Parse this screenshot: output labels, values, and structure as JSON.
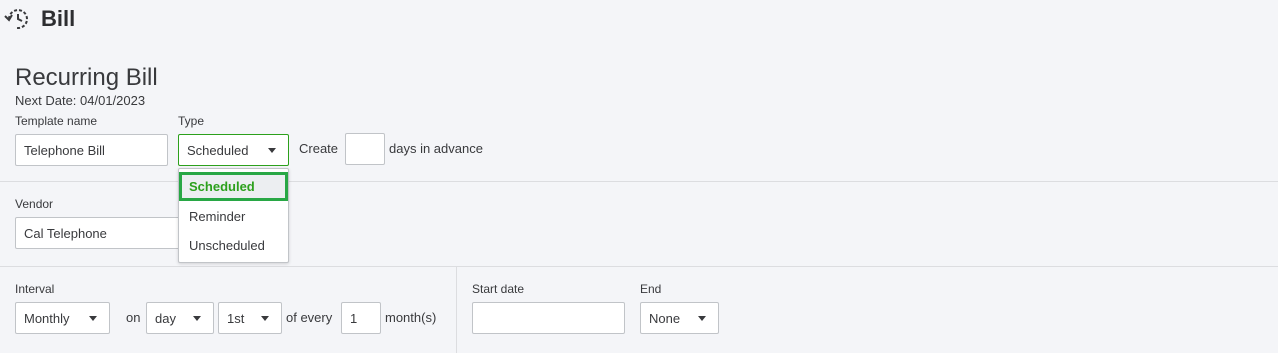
{
  "header": {
    "title": "Bill",
    "icon": "recurring-clock-icon"
  },
  "recurring": {
    "title": "Recurring Bill",
    "next_date": "Next Date: 04/01/2023"
  },
  "template_name": {
    "label": "Template name",
    "value": "Telephone Bill"
  },
  "type": {
    "label": "Type",
    "value": "Scheduled",
    "options": [
      "Scheduled",
      "Reminder",
      "Unscheduled"
    ],
    "selected_index": 0
  },
  "create": {
    "prefix": "Create",
    "value": "",
    "suffix": "days in advance"
  },
  "vendor": {
    "label": "Vendor",
    "value": "Cal Telephone"
  },
  "interval": {
    "label": "Interval",
    "value": "Monthly",
    "on_label": "on",
    "day_value": "day",
    "nth_value": "1st",
    "every_label": "of every",
    "every_value": "1",
    "unit_label": "month(s)"
  },
  "start_date": {
    "label": "Start date",
    "value": ""
  },
  "end": {
    "label": "End",
    "value": "None"
  },
  "colors": {
    "accent": "#2ca01c",
    "highlight": "#28a745",
    "background": "#f4f5f8"
  }
}
